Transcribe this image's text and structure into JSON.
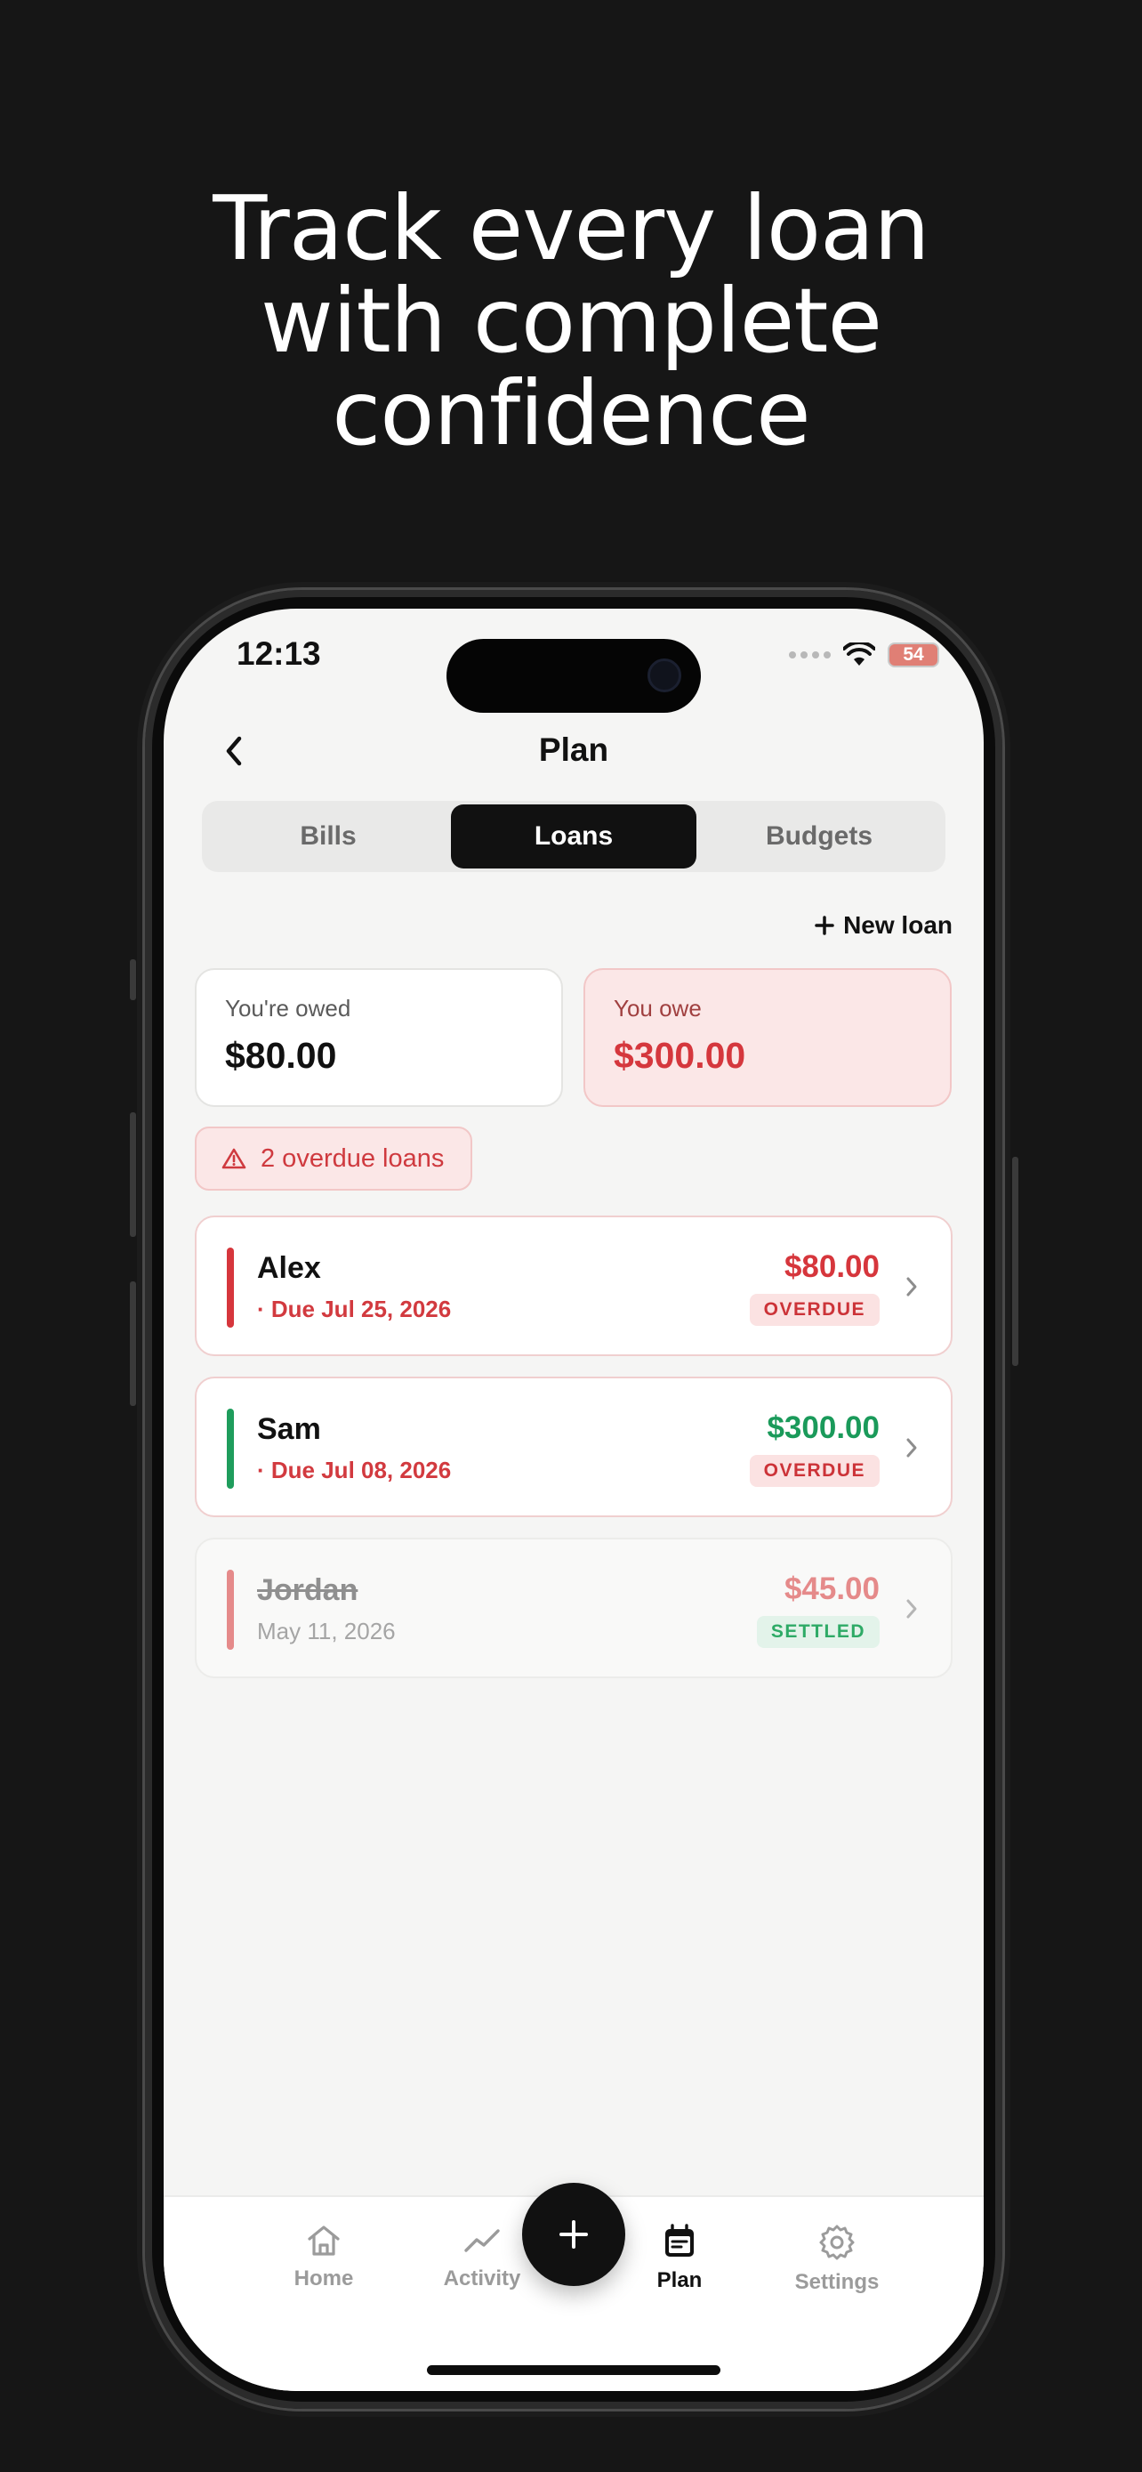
{
  "headline": [
    "Track every loan",
    "with complete",
    "confidence"
  ],
  "status_bar": {
    "time": "12:13",
    "battery": "54"
  },
  "nav": {
    "title": "Plan"
  },
  "segments": [
    {
      "label": "Bills",
      "active": false
    },
    {
      "label": "Loans",
      "active": true
    },
    {
      "label": "Budgets",
      "active": false
    }
  ],
  "new_loan_label": "New loan",
  "summary": {
    "owed_label": "You're owed",
    "owed_amount": "$80.00",
    "owe_label": "You owe",
    "owe_amount": "$300.00"
  },
  "overdue_notice": "2 overdue loans",
  "loans": [
    {
      "name": "Alex",
      "due": "· Due Jul 25, 2026",
      "amount": "$80.00",
      "status": "OVERDUE",
      "bar_color": "#d6363c",
      "amount_color": "#d6363c"
    },
    {
      "name": "Sam",
      "due": "· Due Jul 08, 2026",
      "amount": "$300.00",
      "status": "OVERDUE",
      "bar_color": "#1f9d5c",
      "amount_color": "#1a9a5a"
    },
    {
      "name": "Jordan",
      "due": "May 11, 2026",
      "amount": "$45.00",
      "status": "SETTLED",
      "bar_color": "#e58a8a",
      "amount_color": "#e58a8a"
    }
  ],
  "tabs": [
    {
      "label": "Home",
      "icon": "home-icon",
      "active": false
    },
    {
      "label": "Activity",
      "icon": "activity-icon",
      "active": false
    },
    {
      "label": "Plan",
      "icon": "calendar-icon",
      "active": true
    },
    {
      "label": "Settings",
      "icon": "gear-icon",
      "active": false
    }
  ],
  "colors": {
    "accent_red": "#d5373d",
    "accent_green": "#1a9a5a",
    "dark": "#111111"
  }
}
